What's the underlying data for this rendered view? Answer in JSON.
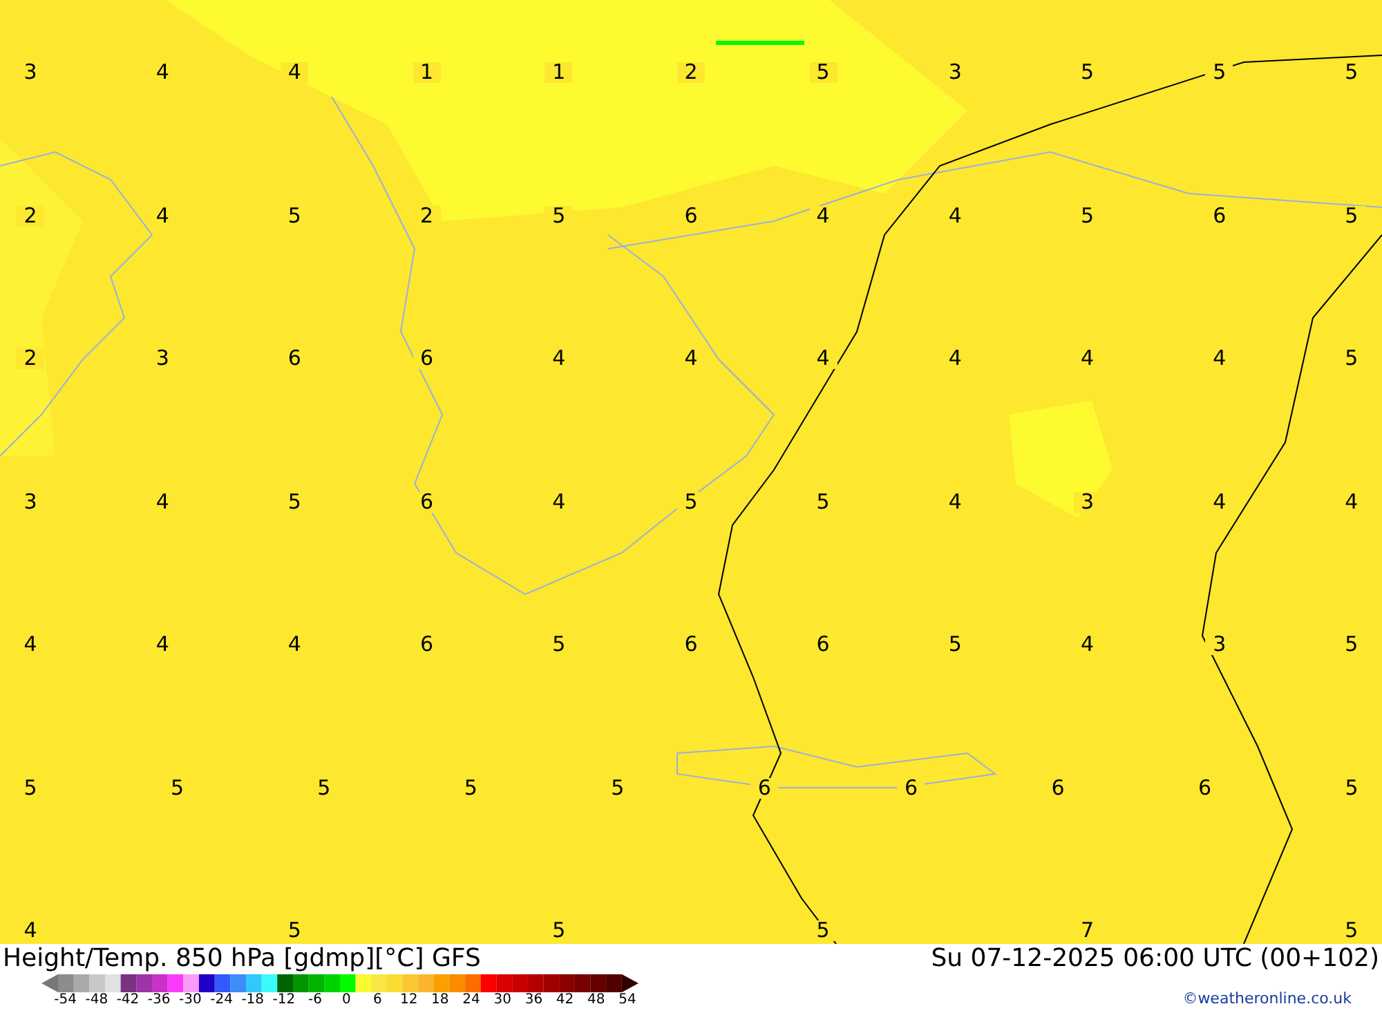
{
  "map": {
    "value_rows": [
      [
        "3",
        "4",
        "4",
        "1",
        "1",
        "2",
        "5",
        "3",
        "5",
        "5",
        "5"
      ],
      [
        "2",
        "4",
        "5",
        "2",
        "5",
        "6",
        "4",
        "4",
        "5",
        "6",
        "5"
      ],
      [
        "2",
        "3",
        "6",
        "6",
        "4",
        "4",
        "4",
        "4",
        "4",
        "4",
        "5"
      ],
      [
        "3",
        "4",
        "5",
        "6",
        "4",
        "5",
        "5",
        "4",
        "3",
        "4",
        "4"
      ],
      [
        "4",
        "4",
        "4",
        "6",
        "5",
        "6",
        "6",
        "5",
        "4",
        "3",
        "5"
      ],
      [
        "5",
        "5",
        "5",
        "5",
        "5",
        "6",
        "6",
        "6",
        "6",
        "5"
      ],
      [
        "4",
        "5",
        "5",
        "5",
        "7",
        "5"
      ]
    ]
  },
  "footer": {
    "title": "Height/Temp. 850 hPa [gdmp][°C] GFS",
    "valid_time": "Su 07-12-2025 06:00 UTC (00+102)",
    "copyright": "©weatheronline.co.uk",
    "scale_labels": [
      "-54",
      "-48",
      "-42",
      "-36",
      "-30",
      "-24",
      "-18",
      "-12",
      "-6",
      "0",
      "6",
      "12",
      "18",
      "24",
      "30",
      "36",
      "42",
      "48",
      "54"
    ]
  }
}
